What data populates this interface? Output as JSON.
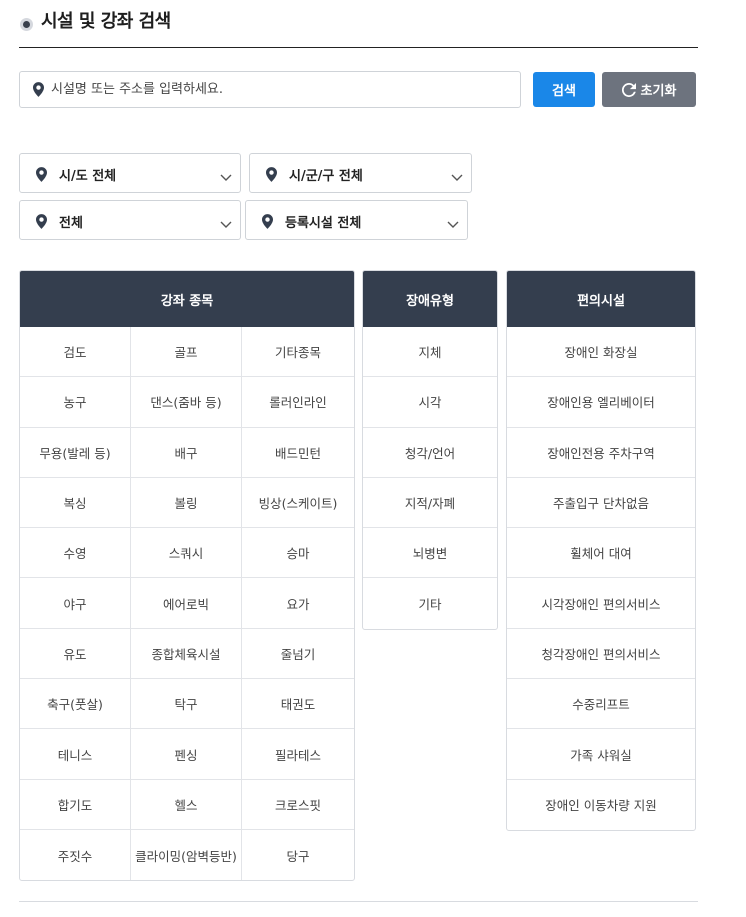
{
  "header": {
    "title": "시설 및 강좌 검색"
  },
  "search": {
    "placeholder": "시설명 또는 주소를 입력하세요.",
    "value": "",
    "search_label": "검색",
    "reset_label": "초기화"
  },
  "filters": {
    "sido": "시/도 전체",
    "sigungu": "시/군/구 전체",
    "type": "전체",
    "registered": "등록시설 전체"
  },
  "sports": {
    "header": "강좌 종목",
    "items": [
      "검도",
      "골프",
      "기타종목",
      "농구",
      "댄스(줌바 등)",
      "롤러인라인",
      "무용(발레 등)",
      "배구",
      "배드민턴",
      "복싱",
      "볼링",
      "빙상(스케이트)",
      "수영",
      "스쿼시",
      "승마",
      "야구",
      "에어로빅",
      "요가",
      "유도",
      "종합체육시설",
      "줄넘기",
      "축구(풋살)",
      "탁구",
      "태권도",
      "테니스",
      "펜싱",
      "필라테스",
      "합기도",
      "헬스",
      "크로스핏",
      "주짓수",
      "클라이밍(암벽등반)",
      "당구"
    ]
  },
  "disability": {
    "header": "장애유형",
    "items": [
      "지체",
      "시각",
      "청각/언어",
      "지적/자폐",
      "뇌병변",
      "기타"
    ]
  },
  "amenities": {
    "header": "편의시설",
    "items": [
      "장애인 화장실",
      "장애인용 엘리베이터",
      "장애인전용 주차구역",
      "주출입구 단차없음",
      "휠체어 대여",
      "시각장애인 편의서비스",
      "청각장애인 편의서비스",
      "수중리프트",
      "가족 샤워실",
      "장애인 이동차량 지원"
    ]
  },
  "colors": {
    "primary": "#1a87e8",
    "reset": "#6d737e",
    "header_bg": "#343e4e",
    "border": "#cfd3d8"
  },
  "icons": {
    "pin": "map-pin-icon",
    "chevron": "chevron-down-icon",
    "reset": "refresh-icon",
    "bullet": "title-bullet-icon"
  }
}
